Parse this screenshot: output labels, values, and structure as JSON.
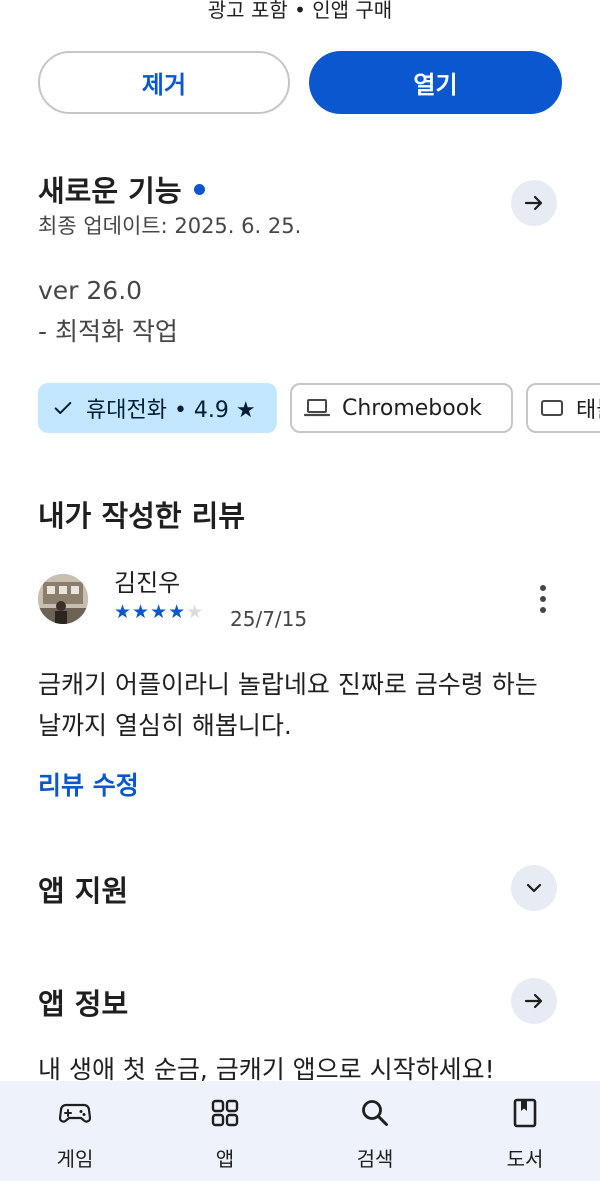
{
  "header": {
    "note": "광고 포함 • 인앱 구매"
  },
  "actions": {
    "remove_label": "제거",
    "open_label": "열기"
  },
  "whats_new": {
    "title": "새로운 기능",
    "updated": "최종 업데이트: 2025. 6. 25.",
    "version": "ver 26.0",
    "note": "- 최적화 작업"
  },
  "device_chips": [
    {
      "label": "휴대전화 • 4.9 ★",
      "selected": true
    },
    {
      "label": "Chromebook",
      "selected": false
    },
    {
      "label": "태블릿",
      "selected": false
    }
  ],
  "my_review": {
    "title": "내가 작성한 리뷰",
    "reviewer": "김진우",
    "rating": 4,
    "max_rating": 5,
    "date": "25/7/15",
    "text": "금캐기 어플이라니 놀랍네요 진짜로 금수령 하는날까지 열심히 해봅니다.",
    "edit_label": "리뷰 수정"
  },
  "app_support": {
    "title": "앱 지원"
  },
  "app_info": {
    "title": "앱 정보",
    "description": "내 생애 첫 순금, 금캐기 앱으로 시작하세요!"
  },
  "bottom_nav": [
    {
      "label": "게임",
      "icon": "gamepad-icon"
    },
    {
      "label": "앱",
      "icon": "apps-grid-icon"
    },
    {
      "label": "검색",
      "icon": "search-icon"
    },
    {
      "label": "도서",
      "icon": "book-icon"
    }
  ],
  "colors": {
    "accent": "#0b57d0",
    "chip_selected_bg": "#c2e7ff",
    "nav_bg": "#eef2fa"
  }
}
